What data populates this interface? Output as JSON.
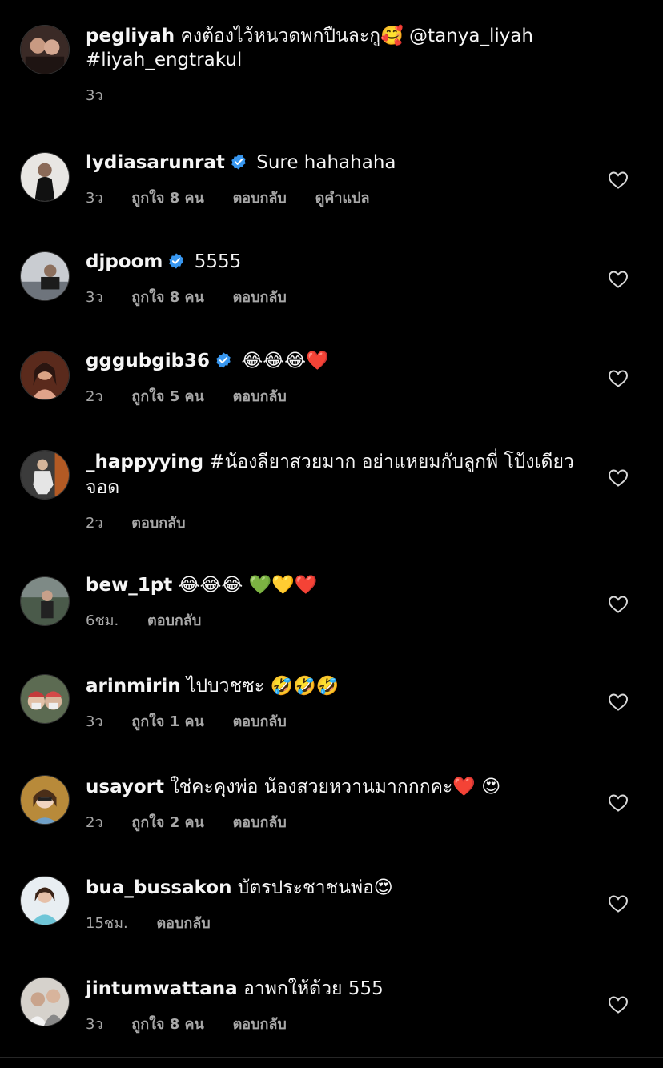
{
  "caption": {
    "username": "pegliyah",
    "text": "คงต้องไว้หนวดพกปืนละกู🥰 @tanya_liyah #liyah_engtrakul",
    "time": "3ว"
  },
  "labels": {
    "reply": "ตอบกลับ",
    "translate": "ดูคำแปล"
  },
  "comments": [
    {
      "username": "lydiasarunrat",
      "verified": true,
      "text": "Sure hahahaha",
      "time": "3ว",
      "likes": "ถูกใจ 8 คน",
      "reply": "ตอบกลับ",
      "translate": "ดูคำแปล"
    },
    {
      "username": "djpoom",
      "verified": true,
      "text": "5555",
      "time": "3ว",
      "likes": "ถูกใจ 8 คน",
      "reply": "ตอบกลับ"
    },
    {
      "username": "gggubgib36",
      "verified": true,
      "text": "😂😂😂❤️",
      "time": "2ว",
      "likes": "ถูกใจ 5 คน",
      "reply": "ตอบกลับ"
    },
    {
      "username": "_happyying",
      "verified": false,
      "text": "#น้องลียาสวยมาก อย่าแหยมกับลูกพี่ โป้งเดียวจอด",
      "time": "2ว",
      "reply": "ตอบกลับ"
    },
    {
      "username": "bew_1pt",
      "verified": false,
      "text": "😂😂😂 💚💛❤️",
      "time": "6ชม.",
      "reply": "ตอบกลับ"
    },
    {
      "username": "arinmirin",
      "verified": false,
      "text": "ไปบวชซะ 🤣🤣🤣",
      "time": "3ว",
      "likes": "ถูกใจ 1 คน",
      "reply": "ตอบกลับ"
    },
    {
      "username": "usayort",
      "verified": false,
      "text": "ใช่คะคุงพ่อ น้องสวยหวานมากกกคะ❤️ 😍",
      "time": "2ว",
      "likes": "ถูกใจ 2 คน",
      "reply": "ตอบกลับ"
    },
    {
      "username": "bua_bussakon",
      "verified": false,
      "text": "บัตรประชาชนพ่อ😍",
      "time": "15ชม.",
      "reply": "ตอบกลับ"
    },
    {
      "username": "jintumwattana",
      "verified": false,
      "text": "อาพกให้ด้วย 555",
      "time": "3ว",
      "likes": "ถูกใจ 8 คน",
      "reply": "ตอบกลับ"
    }
  ],
  "icons": {
    "verified": "verified-badge-icon",
    "like": "heart-outline-icon"
  },
  "colors": {
    "background": "#000000",
    "text": "#f5f5f5",
    "secondary": "#a8a8a8",
    "verified": "#3897f0",
    "divider": "#262626"
  }
}
